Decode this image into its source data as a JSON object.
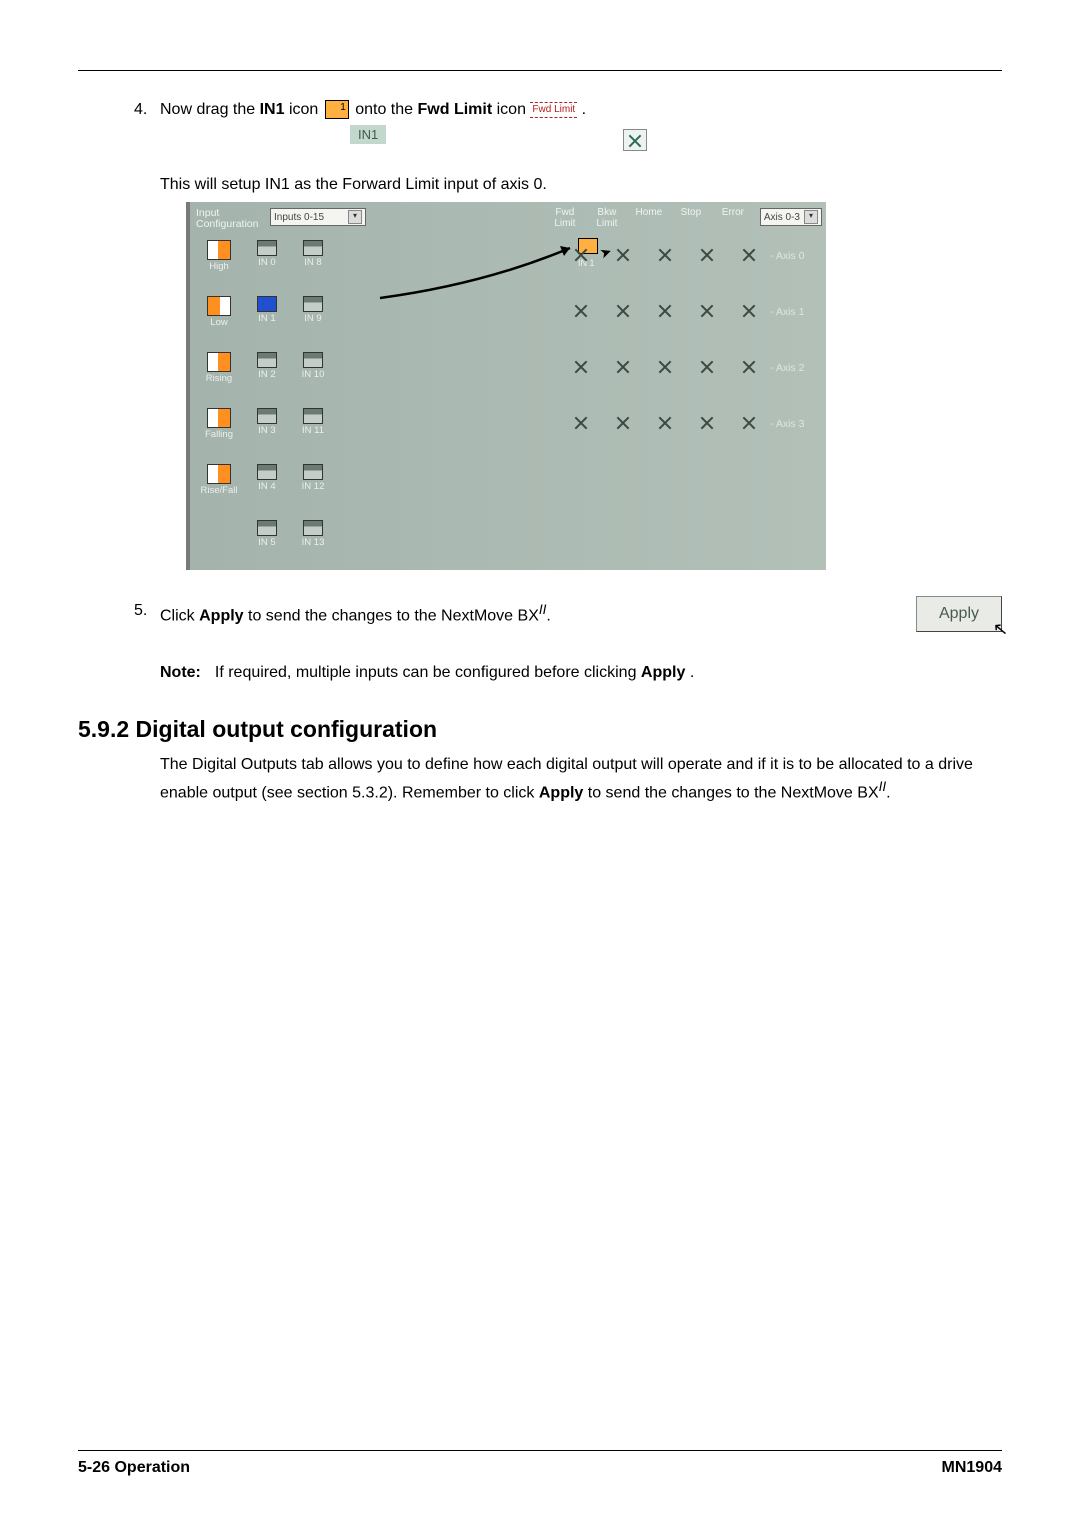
{
  "step4": {
    "num": "4.",
    "pre": "Now drag the ",
    "bold1": "IN1",
    "mid1": " icon ",
    "mid2": " onto the ",
    "bold2": "Fwd Limit",
    "mid3": " icon ",
    "fwd_label": "Fwd Limit",
    "post": ".",
    "in1_label": "IN1",
    "follow": "This will setup IN1 as the Forward Limit input of axis 0."
  },
  "config": {
    "hdr_label": "Input Configuration",
    "inputs_box": "Inputs 0-15",
    "col_fwd": "Fwd Limit",
    "col_bkw": "Bkw Limit",
    "col_home": "Home",
    "col_stop": "Stop",
    "col_err": "Error",
    "last_box": "Axis 0-3",
    "rows": [
      {
        "left": "High",
        "c1": "IN 0",
        "c2": "IN 8",
        "drag_lbl": "IN 1",
        "axis": "- Axis 0",
        "targets": 5
      },
      {
        "left": "Low",
        "c1": "IN 1",
        "c2": "IN 9",
        "axis": "- Axis 1",
        "targets": 5
      },
      {
        "left": "Rising",
        "c1": "IN 2",
        "c2": "IN 10",
        "axis": "- Axis 2",
        "targets": 5
      },
      {
        "left": "Falling",
        "c1": "IN 3",
        "c2": "IN 11",
        "axis": "- Axis 3",
        "targets": 5
      },
      {
        "left": "Rise/Fall",
        "c1": "IN 4",
        "c2": "IN 12",
        "axis": "",
        "targets": 0
      },
      {
        "left": "",
        "c1": "IN 5",
        "c2": "IN 13",
        "axis": "",
        "targets": 0
      }
    ]
  },
  "step5": {
    "num": "5.",
    "pre": "Click ",
    "bold1": "Apply",
    "mid": " to send the changes to the NextMove BX",
    "sup": "II",
    "post": ".",
    "button": "Apply"
  },
  "note": {
    "label": "Note:",
    "pre": "If required, multiple inputs can be configured before clicking ",
    "bold": "Apply",
    "post": "."
  },
  "section": {
    "heading": "5.9.2 Digital output configuration",
    "body_pre": "The Digital Outputs tab allows you to define how each digital output will operate and if it is to be allocated to a drive enable output (see section 5.3.2). Remember to click ",
    "body_bold": "Apply",
    "body_mid": " to send the changes to the NextMove BX",
    "body_sup": "II",
    "body_post": "."
  },
  "footer": {
    "left": "5-26  Operation",
    "right": "MN1904"
  }
}
